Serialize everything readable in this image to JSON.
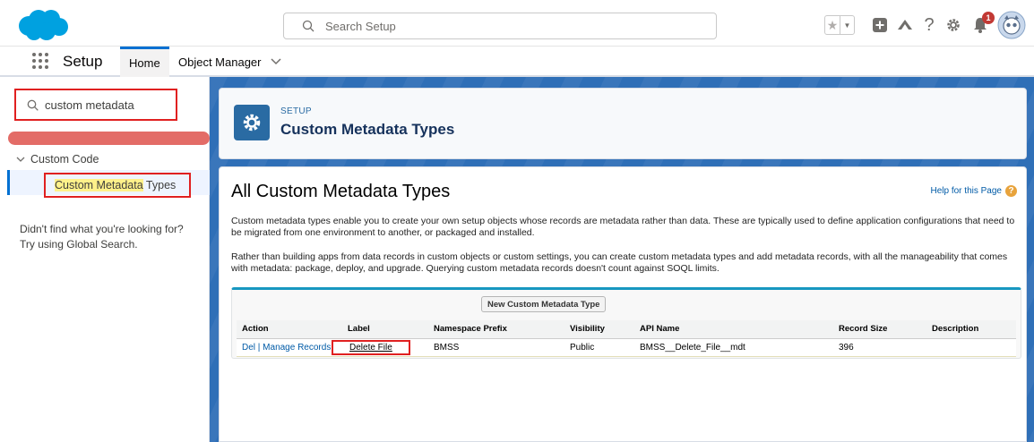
{
  "header": {
    "search_placeholder": "Search Setup",
    "notification_count": "1"
  },
  "nav": {
    "app_name": "Setup",
    "tabs": [
      {
        "label": "Home"
      },
      {
        "label": "Object Manager"
      }
    ]
  },
  "sidebar": {
    "quick_find_value": "custom metadata",
    "tree_section": "Custom Code",
    "tree_item_highlight": "Custom Metadata",
    "tree_item_rest": " Types",
    "not_found_line1": "Didn't find what you're looking for?",
    "not_found_line2": "Try using Global Search."
  },
  "page_header": {
    "eyebrow": "SETUP",
    "title": "Custom Metadata Types"
  },
  "content": {
    "title": "All Custom Metadata Types",
    "help_link": "Help for this Page",
    "paragraph1": "Custom metadata types enable you to create your own setup objects whose records are metadata rather than data. These are typically used to define application configurations that need to be migrated from one environment to another, or packaged and installed.",
    "paragraph2": "Rather than building apps from data records in custom objects or custom settings, you can create custom metadata types and add metadata records, with all the manageability that comes with metadata: package, deploy, and upgrade. Querying custom metadata records doesn't count against SOQL limits.",
    "new_button": "New Custom Metadata Type",
    "table": {
      "columns": [
        "Action",
        "Label",
        "Namespace Prefix",
        "Visibility",
        "API Name",
        "Record Size",
        "Description"
      ],
      "rows": [
        {
          "action_del": "Del",
          "action_sep": " | ",
          "action_manage": "Manage Records",
          "label": "Delete File",
          "namespace": "BMSS",
          "visibility": "Public",
          "api_name": "BMSS__Delete_File__mdt",
          "record_size": "396",
          "description": ""
        }
      ]
    }
  },
  "colors": {
    "brand_blue": "#0070d2",
    "highlight_red": "#e02020",
    "page_bg": "#2f6fb7"
  }
}
